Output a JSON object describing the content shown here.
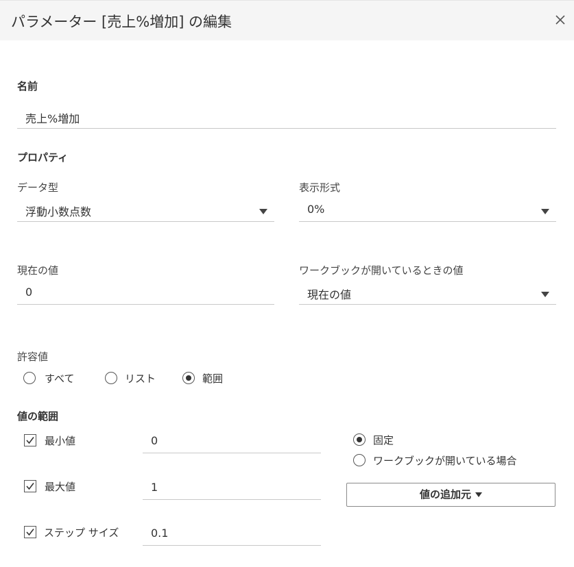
{
  "dialog": {
    "title": "パラメーター [売上%増加] の編集",
    "close_icon": "close-icon"
  },
  "name_section": {
    "label": "名前",
    "value": "売上%増加"
  },
  "properties": {
    "heading": "プロパティ",
    "data_type": {
      "label": "データ型",
      "value": "浮動小数点数"
    },
    "display_format": {
      "label": "表示形式",
      "value": "0%"
    },
    "current_value": {
      "label": "現在の値",
      "value": "0"
    },
    "workbook_open_value": {
      "label": "ワークブックが開いているときの値",
      "value": "現在の値"
    }
  },
  "allowable": {
    "label": "許容値",
    "options": [
      "すべて",
      "リスト",
      "範囲"
    ],
    "selected": "範囲"
  },
  "range": {
    "heading": "値の範囲",
    "min": {
      "label": "最小値",
      "value": "0",
      "checked": true
    },
    "max": {
      "label": "最大値",
      "value": "1",
      "checked": true
    },
    "step": {
      "label": "ステップ サイズ",
      "value": "0.1",
      "checked": true
    },
    "mode_options": [
      "固定",
      "ワークブックが開いている場合"
    ],
    "mode_selected": "固定",
    "add_from_label": "値の追加元"
  }
}
